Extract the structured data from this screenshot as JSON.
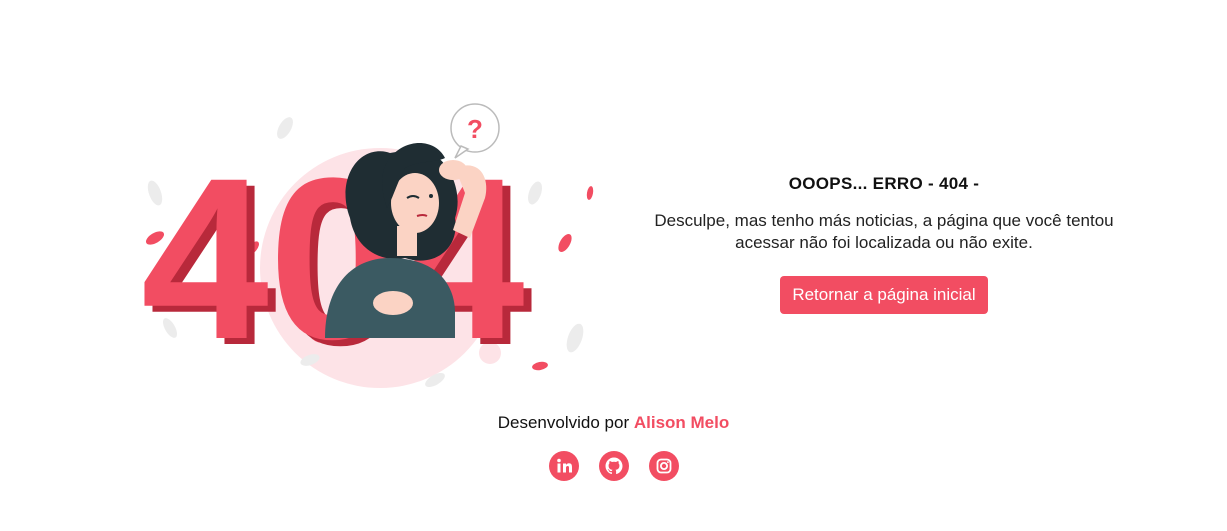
{
  "illustration": {
    "number_text": "404",
    "question_mark": "?",
    "accent_color": "#f24d62",
    "dark_accent_color": "#b8293b",
    "hair_color": "#1f2d33",
    "shirt_color": "#3b5a62"
  },
  "error": {
    "title": "OOOPS... ERRO - 404 -",
    "message": "Desculpe, mas tenho más noticias, a página que você tentou acessar não foi localizada ou não exite.",
    "button_label": "Retornar a página inicial"
  },
  "footer": {
    "credit_prefix": "Desenvolvido por",
    "author_name": "Alison Melo",
    "socials": [
      {
        "icon": "linkedin-icon"
      },
      {
        "icon": "github-icon"
      },
      {
        "icon": "instagram-icon"
      }
    ]
  },
  "colors": {
    "accent": "#f24d62",
    "text": "#111111",
    "background": "#ffffff"
  }
}
